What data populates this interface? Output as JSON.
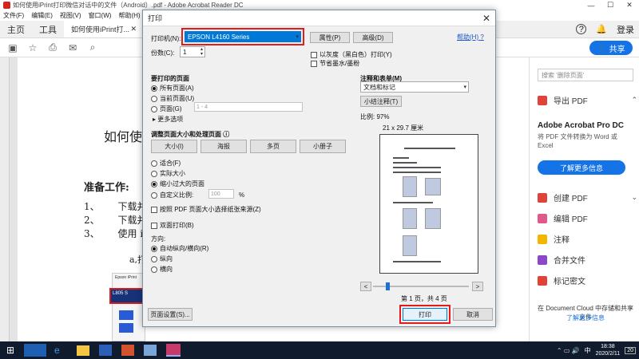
{
  "app": {
    "window_title": "如何使用iPrint打印微信对话中的文件（Android）.pdf - Adobe Acrobat Reader DC",
    "menu": [
      "文件(F)",
      "编辑(E)",
      "视图(V)",
      "窗口(W)",
      "帮助(H)"
    ],
    "tabs": {
      "home": "主页",
      "tools": "工具",
      "doc": "如何使用iPrint打..."
    },
    "signin": "登录",
    "share": "共享"
  },
  "document": {
    "title_fragment": "如何使",
    "heading": "准备工作:",
    "list": [
      {
        "num": "1、",
        "text": "下载并"
      },
      {
        "num": "2、",
        "text": "下载并"
      },
      {
        "num": "3、",
        "text": "使用 i"
      }
    ],
    "sub": "a,打",
    "img_label": "Epson iPrint",
    "img_printer": "L805 S"
  },
  "right_panel": {
    "search_placeholder": "搜索 '删除页面'",
    "export_pdf": "导出 PDF",
    "promo_title": "Adobe Acrobat Pro DC",
    "promo_text": "将 PDF 文件转换为 Word 或 Excel",
    "promo_button": "了解更多信息",
    "items": [
      "创建 PDF",
      "编辑 PDF",
      "注释",
      "合并文件",
      "标记密文"
    ],
    "cloud_text": "在 Document Cloud 中存储和共享文件",
    "cloud_link": "了解更多信息"
  },
  "dialog": {
    "title": "打印",
    "printer_label": "打印机(N):",
    "printer_value": "EPSON L4160 Series",
    "properties": "属性(P)",
    "advanced": "高级(D)",
    "help": "帮助(H)",
    "copies_label": "份数(C):",
    "copies_value": "1",
    "grayscale": "以灰度（黑白色）打印(Y)",
    "save_ink": "节省墨水/墨粉",
    "pages_title": "要打印的页面",
    "all_pages": "所有页面(A)",
    "current_page": "当前页面(U)",
    "pages": "页面(G)",
    "pages_placeholder": "1 - 4",
    "more_options": "更多选项",
    "sizing_title": "调整页面大小和处理页面",
    "size_btn": "大小(I)",
    "poster_btn": "海报",
    "multiple_btn": "多页",
    "booklet_btn": "小册子",
    "fit": "适合(F)",
    "actual_size": "实际大小",
    "shrink": "缩小过大的页面",
    "custom_scale": "自定义比例:",
    "scale_value": "100",
    "percent": "%",
    "paper_source": "按照 PDF 页面大小选择纸张来源(Z)",
    "duplex": "双面打印(B)",
    "orientation_title": "方向:",
    "auto": "自动纵向/横向(R)",
    "portrait": "纵向",
    "landscape": "横向",
    "comments_title": "注释和表单(M)",
    "comments_value": "文档和标记",
    "summarize": "小结注释(T)",
    "scale_label": "比例:",
    "scale_pct": "97%",
    "paper_size": "21 x 29.7 厘米",
    "page_info": "第 1 页，共 4 页",
    "page_setup": "页面设置(S)...",
    "print": "打印",
    "cancel": "取消",
    "prev": "<",
    "next": ">"
  },
  "taskbar": {
    "time": "18:38",
    "date": "2020/2/11",
    "lang": "中",
    "badge": "20"
  },
  "colors": {
    "accent": "#1473e6",
    "highlight": "#e21b1b",
    "selection": "#0078d7"
  }
}
